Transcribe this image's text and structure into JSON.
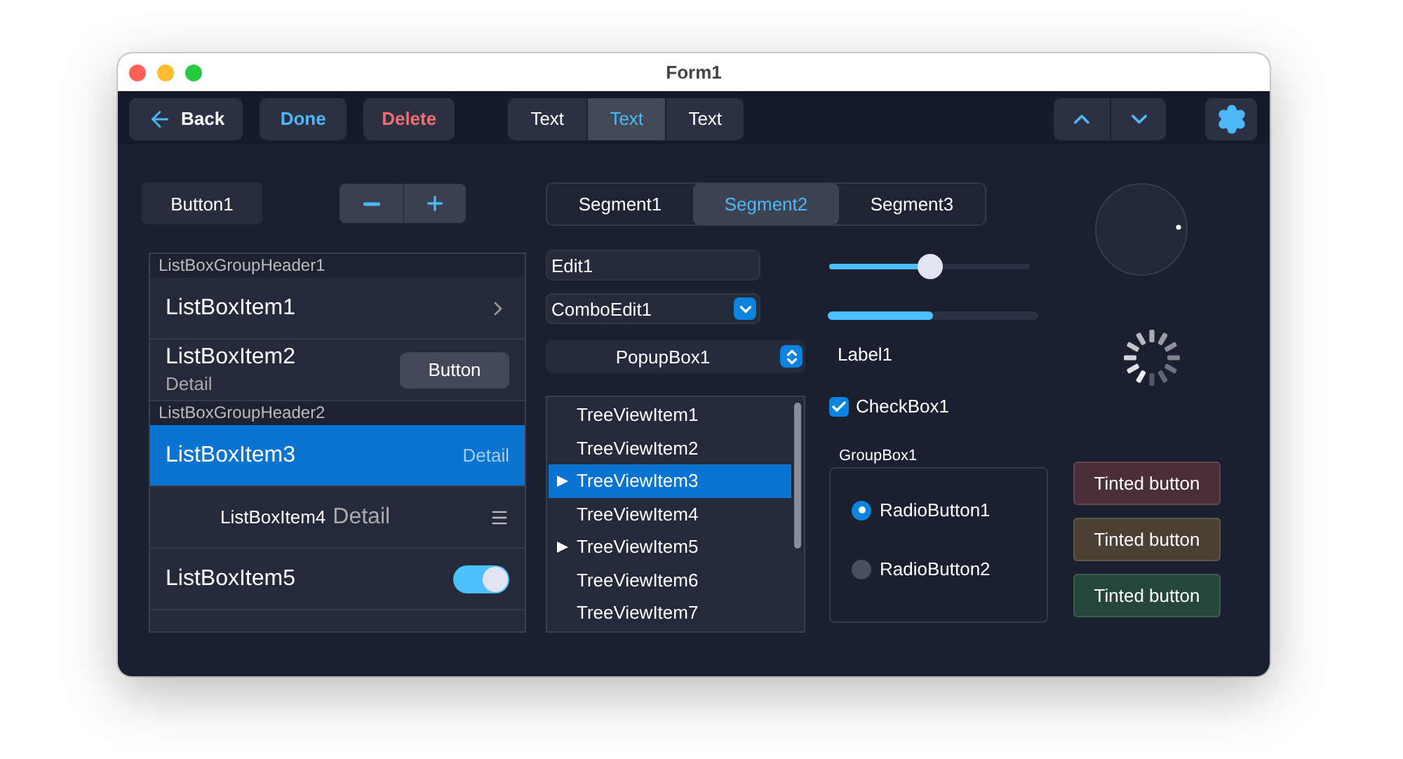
{
  "window": {
    "title": "Form1"
  },
  "toolbar": {
    "buttons": [
      {
        "kind": "back",
        "label": "Back"
      },
      {
        "kind": "accent",
        "label": "Done"
      },
      {
        "kind": "danger",
        "label": "Delete"
      }
    ],
    "segments": [
      {
        "label": "Text",
        "selected": false
      },
      {
        "label": "Text",
        "selected": true
      },
      {
        "label": "Text",
        "selected": false
      }
    ]
  },
  "button": {
    "label": "Button1"
  },
  "segments": [
    {
      "label": "Segment1",
      "selected": false
    },
    {
      "label": "Segment2",
      "selected": true
    },
    {
      "label": "Segment3",
      "selected": false
    }
  ],
  "listbox": {
    "groups": [
      {
        "header": "ListBoxGroupHeader1",
        "items": [
          {
            "kind": "chevron",
            "label": "ListBoxItem1",
            "selected": false
          },
          {
            "kind": "button",
            "label": "ListBoxItem2",
            "detail": "Detail",
            "button": "Button",
            "selected": false
          }
        ]
      },
      {
        "header": "ListBoxGroupHeader2",
        "items": [
          {
            "kind": "detail",
            "label": "ListBoxItem3",
            "detail": "Detail",
            "selected": true
          },
          {
            "kind": "drag",
            "label": "ListBoxItem4",
            "detail": "Detail",
            "selected": false
          },
          {
            "kind": "switch",
            "label": "ListBoxItem5",
            "on": true,
            "selected": false
          }
        ]
      }
    ]
  },
  "edit": {
    "value": "Edit1"
  },
  "combo_edit": {
    "value": "ComboEdit1"
  },
  "popup_box": {
    "value": "PopupBox1"
  },
  "tree": {
    "items": [
      {
        "label": "TreeViewItem1",
        "has_children": false,
        "selected": false
      },
      {
        "label": "TreeViewItem2",
        "has_children": false,
        "selected": false
      },
      {
        "label": "TreeViewItem3",
        "has_children": true,
        "selected": true
      },
      {
        "label": "TreeViewItem4",
        "has_children": false,
        "selected": false
      },
      {
        "label": "TreeViewItem5",
        "has_children": true,
        "selected": false
      },
      {
        "label": "TreeViewItem6",
        "has_children": false,
        "selected": false
      },
      {
        "label": "TreeViewItem7",
        "has_children": false,
        "selected": false
      }
    ]
  },
  "slider": {
    "level": 0.5
  },
  "progress": {
    "level": 0.5
  },
  "label": "Label1",
  "checkbox": {
    "label": "CheckBox1",
    "checked": true
  },
  "group_box": {
    "title": "GroupBox1",
    "radios": [
      {
        "label": "RadioButton1",
        "selected": true
      },
      {
        "label": "RadioButton2",
        "selected": false
      }
    ]
  },
  "tinted_buttons": [
    {
      "label": "Tinted button",
      "color": "#4a2f3b"
    },
    {
      "label": "Tinted button",
      "color": "#4a4033"
    },
    {
      "label": "Tinted button",
      "color": "#25473a"
    }
  ]
}
